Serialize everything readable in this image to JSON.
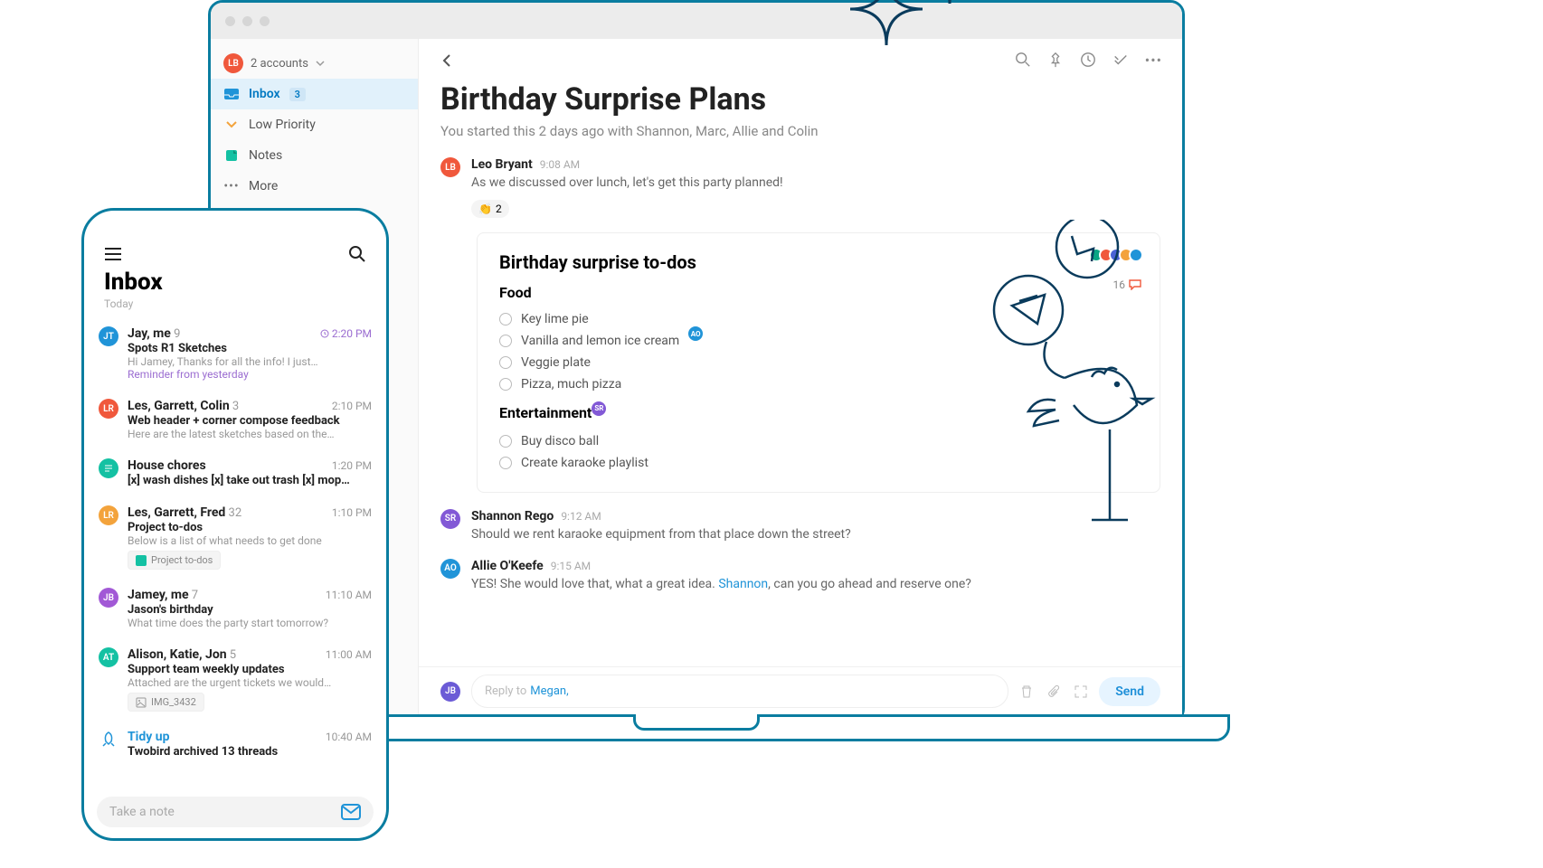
{
  "sidebar": {
    "accounts_label": "2 accounts",
    "avatar_initials": "LB",
    "items": [
      {
        "icon": "inbox",
        "label": "Inbox",
        "badge": "3",
        "active": true
      },
      {
        "icon": "low",
        "label": "Low Priority"
      },
      {
        "icon": "notes",
        "label": "Notes"
      },
      {
        "icon": "more",
        "label": "More"
      }
    ]
  },
  "thread": {
    "title": "Birthday Surprise Plans",
    "subtitle": "You started this 2 days ago with Shannon, Marc, Allie and Colin",
    "messages": [
      {
        "avatar": "LB",
        "color": "#f0583c",
        "author": "Leo Bryant",
        "time": "9:08 AM",
        "text": "As we discussed over lunch, let's get this party planned!",
        "reaction_emoji": "👏",
        "reaction_count": "2"
      },
      {
        "avatar": "SR",
        "color": "#8259d6",
        "author": "Shannon Rego",
        "time": "9:12 AM",
        "text": "Should we rent karaoke equipment from that place down the street?"
      },
      {
        "avatar": "AO",
        "color": "#2094d8",
        "author": "Allie O'Keefe",
        "time": "9:15 AM",
        "text_prefix": "YES! She would love that, what a great idea. ",
        "mention": "Shannon",
        "text_suffix": ", can you go ahead and reserve one?"
      }
    ],
    "todo": {
      "title": "Birthday surprise to-dos",
      "sections": [
        {
          "heading": "Food",
          "items": [
            "Key lime pie",
            "Vanilla and lemon ice cream",
            "Veggie plate",
            "Pizza, much pizza"
          ],
          "cursor_after_idx": 1,
          "cursor_badge": "AO",
          "cursor_color": "#2094d8"
        },
        {
          "heading": "Entertainment",
          "items": [
            "Buy disco ball",
            "Create karaoke playlist"
          ],
          "heading_cursor_badge": "SR",
          "heading_cursor_color": "#8259d6"
        }
      ],
      "presence_colors": [
        "#0aa584",
        "#f0583c",
        "#4a63d6",
        "#f3a33c",
        "#2094d8"
      ],
      "comment_count": "16"
    },
    "reply": {
      "avatar": "JB",
      "avatar_color": "#6b5bd6",
      "prefix": "Reply to ",
      "mention": "Megan,",
      "send_label": "Send"
    }
  },
  "phone": {
    "title": "Inbox",
    "subheading": "Today",
    "items": [
      {
        "avatar": "JT",
        "color": "#2094d8",
        "from": "Jay, me",
        "count": "9",
        "time": "2:20 PM",
        "time_color": "#9b6dd1",
        "time_icon": true,
        "subject": "Spots R1 Sketches",
        "preview": "Hi Jamey, Thanks for all the info! I just…",
        "reminder": "Reminder from yesterday"
      },
      {
        "avatar": "LR",
        "color": "#f0583c",
        "from": "Les, Garrett, Colin",
        "count": "3",
        "time": "2:10 PM",
        "subject": "Web header + corner compose feedback",
        "preview": "Here are the latest sketches based on the…"
      },
      {
        "avatar_icon": "note",
        "color": "#14c1a3",
        "from": "House chores",
        "time": "1:20 PM",
        "subject_as_preview": true,
        "preview": "[x] wash dishes [x] take out trash [x] mop…"
      },
      {
        "avatar": "LR",
        "color": "#f3a33c",
        "from": "Les, Garrett, Fred",
        "count": "32",
        "time": "1:10 PM",
        "subject": "Project to-dos",
        "preview": "Below is a list of what needs to get done",
        "chip": "Project to-dos",
        "chip_icon": "note"
      },
      {
        "avatar": "JB",
        "color": "#a259d6",
        "from": "Jamey, me",
        "count": "7",
        "time": "11:10 AM",
        "subject": "Jason's birthday",
        "preview": "What time does the party start tomorrow?"
      },
      {
        "avatar": "AT",
        "color": "#14c1a3",
        "from": "Alison, Katie, Jon",
        "count": "5",
        "time": "11:00 AM",
        "subject": "Support team weekly updates",
        "preview": "Attached are the urgent tickets we would…",
        "chip": "IMG_3432",
        "chip_icon": "image"
      },
      {
        "avatar_icon": "rocket",
        "color": "#2094d8",
        "from": "Tidy up",
        "from_link": true,
        "time": "10:40 AM",
        "subject": "Twobird archived 13 threads"
      }
    ],
    "compose_placeholder": "Take a note"
  }
}
